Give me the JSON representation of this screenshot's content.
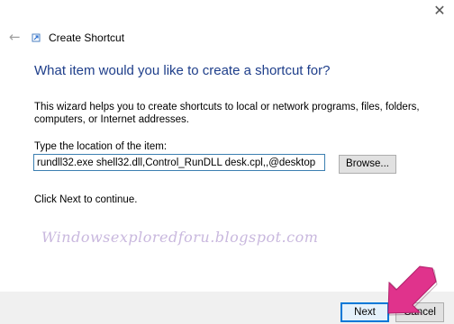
{
  "window": {
    "title": "Create Shortcut",
    "close_glyph": "✕",
    "back_glyph": "←"
  },
  "main": {
    "heading": "What item would you like to create a shortcut for?",
    "description": "This wizard helps you to create shortcuts to local or network programs, files, folders, computers, or Internet addresses.",
    "location_label": "Type the location of the item:",
    "location_value": "rundll32.exe shell32.dll,Control_RunDLL desk.cpl,,@desktop",
    "browse_label": "Browse...",
    "hint": "Click Next to continue."
  },
  "watermark": "Windowsexploredforu.blogspot.com",
  "footer": {
    "next_label": "Next",
    "cancel_label": "Cancel"
  },
  "colors": {
    "heading": "#1e3e8a",
    "accent": "#0078d7",
    "annotation_arrow": "#e0338c",
    "watermark": "#c9b8de"
  },
  "icons": [
    "back-arrow-icon",
    "shortcut-app-icon",
    "close-icon",
    "pointer-arrow-annotation"
  ]
}
